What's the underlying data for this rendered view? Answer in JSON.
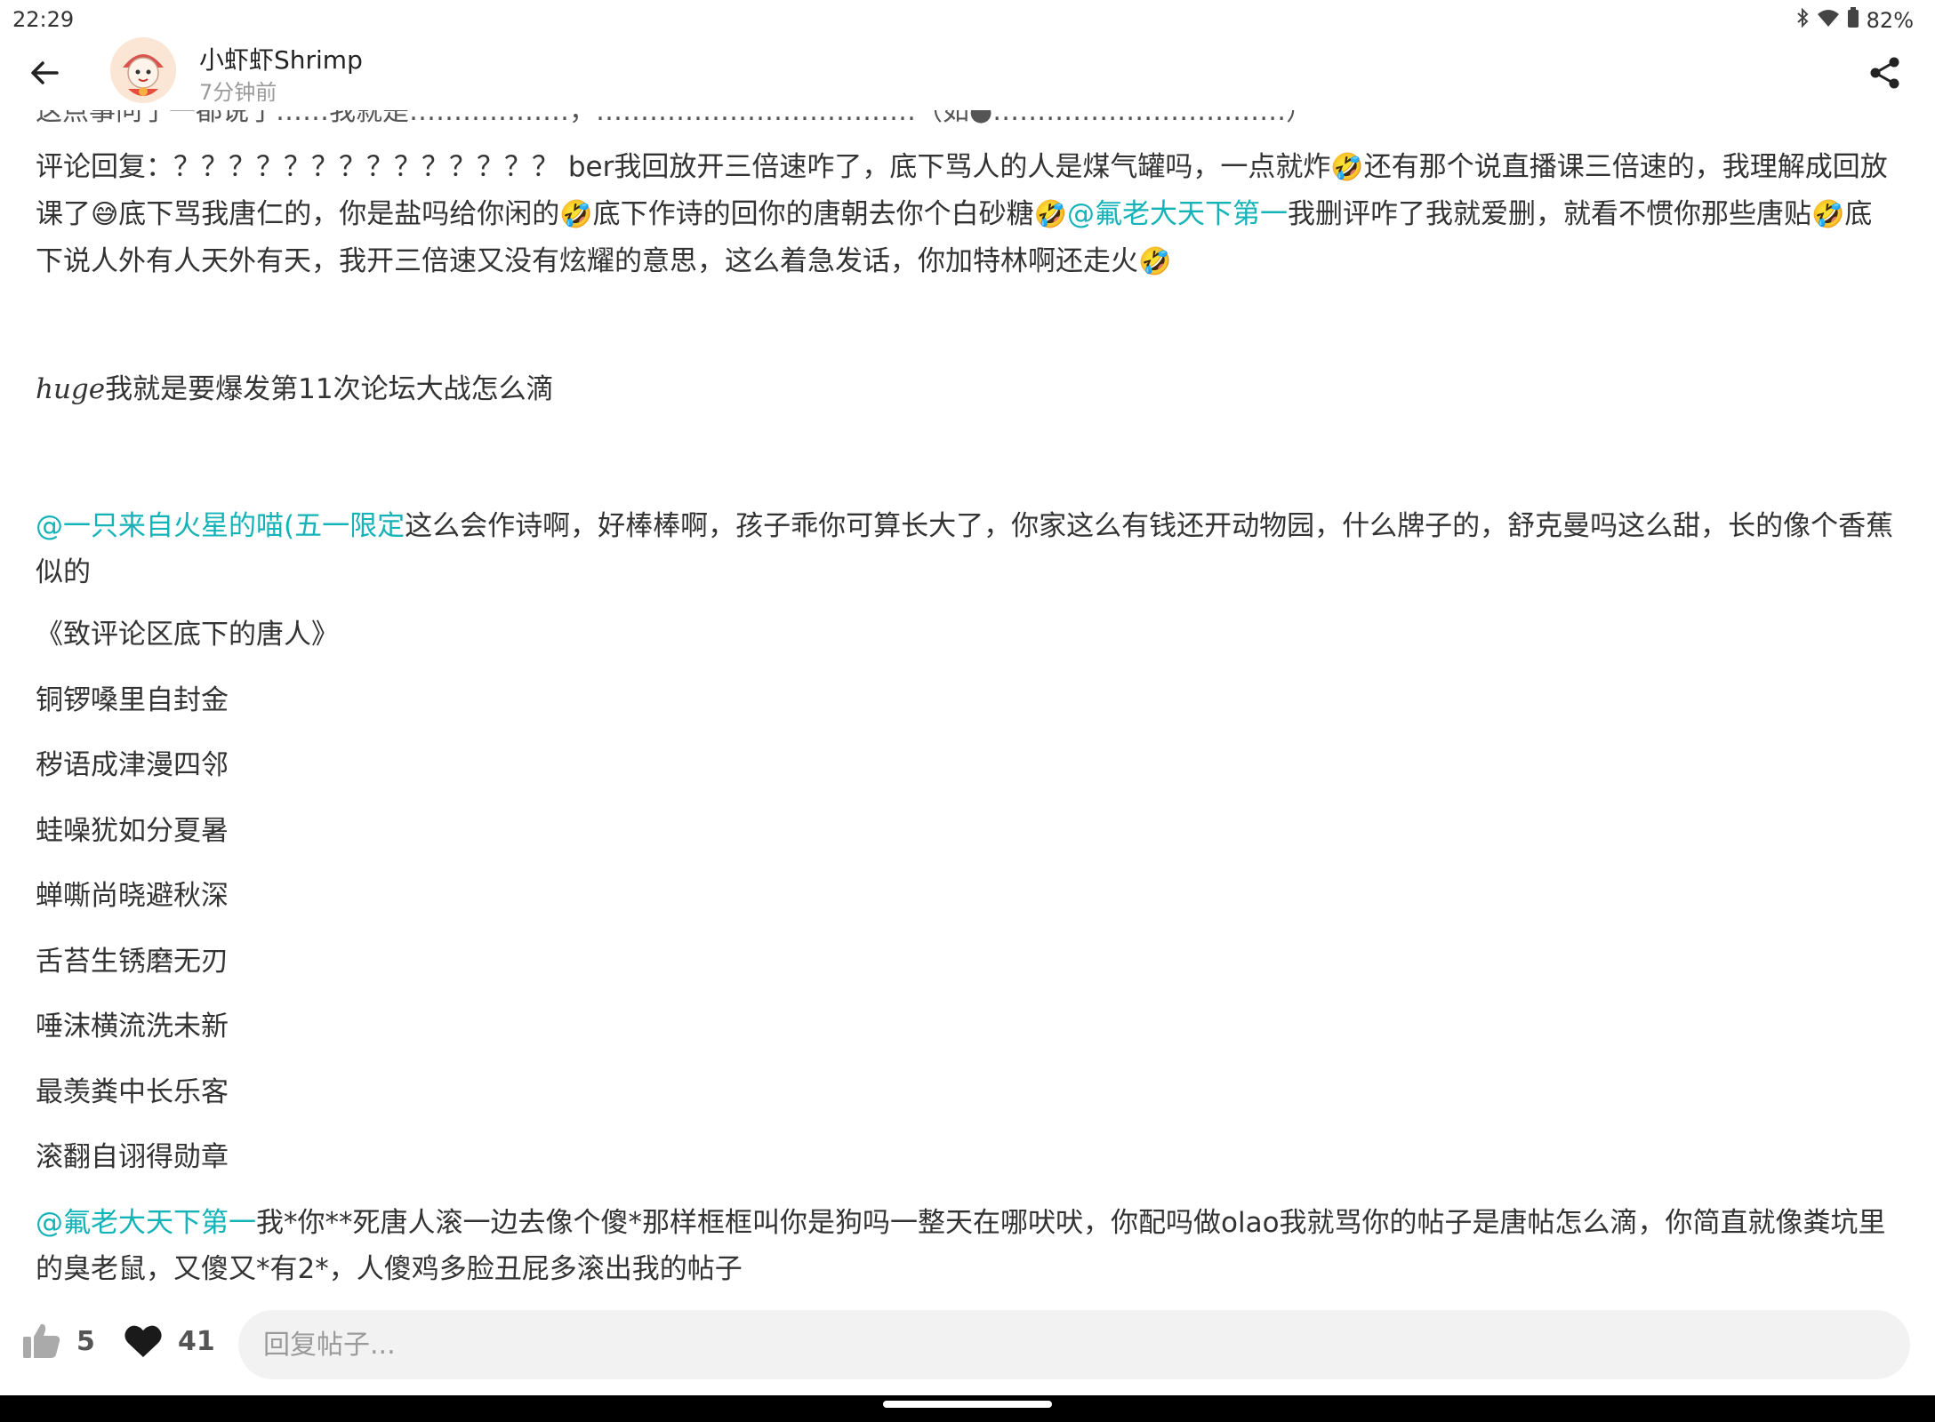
{
  "status_bar": {
    "time": "22:29",
    "battery": "82%",
    "icons": [
      "bluetooth-icon",
      "wifi-icon",
      "battery-icon"
    ]
  },
  "header": {
    "author": "小虾虾Shrimp",
    "time": "7分钟前",
    "back_icon": "arrow-left-icon",
    "share_icon": "share-icon"
  },
  "post": {
    "cut_line": "这点事问了一都说了……我就是………………，………………………………（如●……………………………）",
    "p1": {
      "segments": [
        {
          "t": "评论回复：？？？？？？？？？？？？？？ ber我回放开三倍速咋了，底下骂人的人是煤气罐吗，一点就炸",
          "k": "text"
        },
        {
          "t": "🤣",
          "k": "emoji"
        },
        {
          "t": "还有那个说直播课三倍速的，我理解成回放课了",
          "k": "text"
        },
        {
          "t": "😅",
          "k": "emoji"
        },
        {
          "t": "底下骂我唐仁的，你是盐吗给你闲的",
          "k": "text"
        },
        {
          "t": "🤣",
          "k": "emoji"
        },
        {
          "t": "底下作诗的回你的唐朝去你个白砂糖",
          "k": "text"
        },
        {
          "t": "🤣",
          "k": "emoji"
        },
        {
          "t": "@氟老大天下第一",
          "k": "mention"
        },
        {
          "t": "我删评咋了我就爱删，就看不惯你那些唐贴",
          "k": "text"
        },
        {
          "t": "🤣",
          "k": "emoji"
        },
        {
          "t": "底下说人外有人天外有天，我开三倍速又没有炫耀的意思，这么着急发话，你加特林啊还走火",
          "k": "text"
        },
        {
          "t": "🤣",
          "k": "emoji"
        }
      ]
    },
    "p2_math": "huge",
    "p2_text": "我就是要爆发第11次论坛大战怎么滴",
    "p3_mention": "@一只来自火星的喵(五一限定",
    "p3_text": "这么会作诗啊，好棒棒啊，孩子乖你可算长大了，你家这么有钱还开动物园，什么牌子的，舒克曼吗这么甜，长的像个香蕉似的",
    "poem_title": "《致评论区底下的唐人》",
    "poem_lines": [
      "铜锣嗓里自封金",
      "秽语成津漫四邻",
      "蛙噪犹如分夏暑",
      "蝉嘶尚晓避秋深",
      "舌苔生锈磨无刃",
      "唾沫横流洗未新",
      "最羡粪中长乐客",
      "滚翻自诩得勋章"
    ],
    "p4_mention": "@氟老大天下第一",
    "p4_text": "我*你**死唐人滚一边去像个傻*那样框框叫你是狗吗一整天在哪吠吠，你配吗做olao我就骂你的帖子是唐帖怎么滴，你简直就像粪坑里的臭老鼠，又傻又*有2*，人傻鸡多脸丑屁多滚出我的帖子"
  },
  "bottom_bar": {
    "like_count": "5",
    "favorite_count": "41",
    "reply_placeholder": "回复帖子...",
    "like_icon": "thumbs-up-icon",
    "favorite_icon": "heart-icon"
  }
}
